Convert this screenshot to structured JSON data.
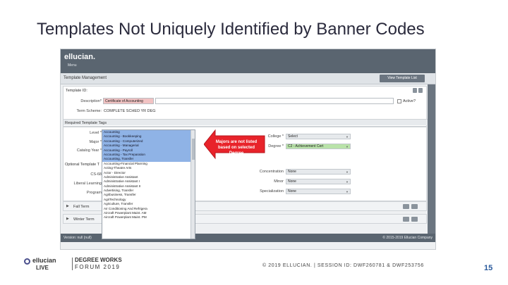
{
  "slide": {
    "title": "Templates Not Uniquely Identified by Banner Codes",
    "page_number": "15",
    "footer_session": "© 2019 ELLUCIAN. | SESSION ID: DWF260781 & DWF253756",
    "footer_brand": {
      "ellucian": "ellucian",
      "live": "LIVE",
      "degree_works": "DEGREE WORKS",
      "forum": "FORUM 2019"
    }
  },
  "app": {
    "brand": "ellucian.",
    "menu": "Menu",
    "page_title": "Template Management",
    "view_template_list_button": "View Template List",
    "template_id_label": "Template ID:",
    "description_label": "Description*",
    "description_value": "Certificate of Accounting",
    "active_label": "Active?",
    "term_scheme_label": "Term Scheme:",
    "term_scheme_value": "COMPLETE SCHED  YR  DEG",
    "required_tags_label": "Required Template Tags",
    "level_label": "Level *",
    "major_label": "Major *",
    "catalog_year_label": "Catalog Year *",
    "optional_tags_label": "Optional Template T",
    "cs_label": "CS-68",
    "liberal_learning_label": "Liberal Learning",
    "program_label": "Program",
    "college_label": "College *",
    "college_value": "Select",
    "degree_label": "Degree *",
    "degree_value": "C2 - Achievement Cert",
    "concentration_label": "Concentration",
    "concentration_value": "None",
    "minor_label": "Minor",
    "minor_value": "None",
    "specialization_label": "Specialization",
    "specialization_value": "None",
    "fall_term": "Fall Term",
    "winter_term": "Winter Term",
    "version": "Version: null (null)",
    "copyright": "© 2015-2019 Ellucian Company"
  },
  "major_list": [
    "Accounting",
    "Accounting - Bookkeeping",
    "Accounting - Computerized",
    "Accounting - Managerial",
    "Accounting - Payroll",
    "Accounting - Tax Preparation",
    "Accounting, Transfer",
    "Accounting-Financial Planning",
    "Acting-Theatre Arts",
    "Actor - Director",
    "Administrative Assistant",
    "Administrative Assistant I",
    "Administrative Assistant II",
    "Advertising, Transfer",
    "Agribusiness, Transfer",
    "AgriTechnology",
    "Agriculture, Transfer",
    "Air Conditioning And Refrigera",
    "Aircraft Powerplant Maint. AM",
    "Aircraft Powerplant Maint. PM"
  ],
  "selected_majors": 7,
  "callout": {
    "text": "Majors are not listed based on selected Degree"
  },
  "colors": {
    "callout_red": "#e8232a",
    "selection_blue": "#8fb3e6",
    "degree_green": "#b9e3a9",
    "description_pink": "#f2c3c3"
  }
}
